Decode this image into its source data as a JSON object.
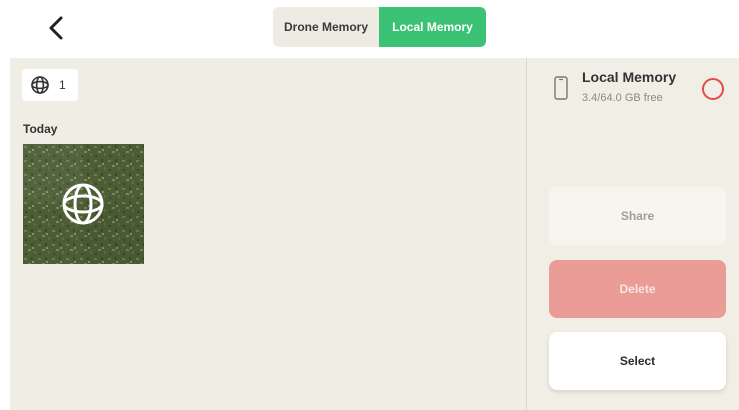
{
  "header": {
    "back_icon": "chevron-left-icon",
    "tabs": [
      {
        "label": "Drone Memory",
        "active": false
      },
      {
        "label": "Local Memory",
        "active": true
      }
    ],
    "accent_color": "#3cc274"
  },
  "gallery": {
    "count_icon": "panorama-sphere-icon",
    "count": "1",
    "sections": [
      {
        "label": "Today",
        "items": [
          {
            "type": "panorama",
            "icon": "panorama-sphere-icon"
          }
        ]
      }
    ]
  },
  "sidebar": {
    "storage": {
      "icon": "phone-icon",
      "title": "Local Memory",
      "subtitle": "3.4/64.0 GB free",
      "radio_color": "#e04b4b"
    },
    "buttons": {
      "share": "Share",
      "delete": "Delete",
      "select": "Select"
    }
  }
}
